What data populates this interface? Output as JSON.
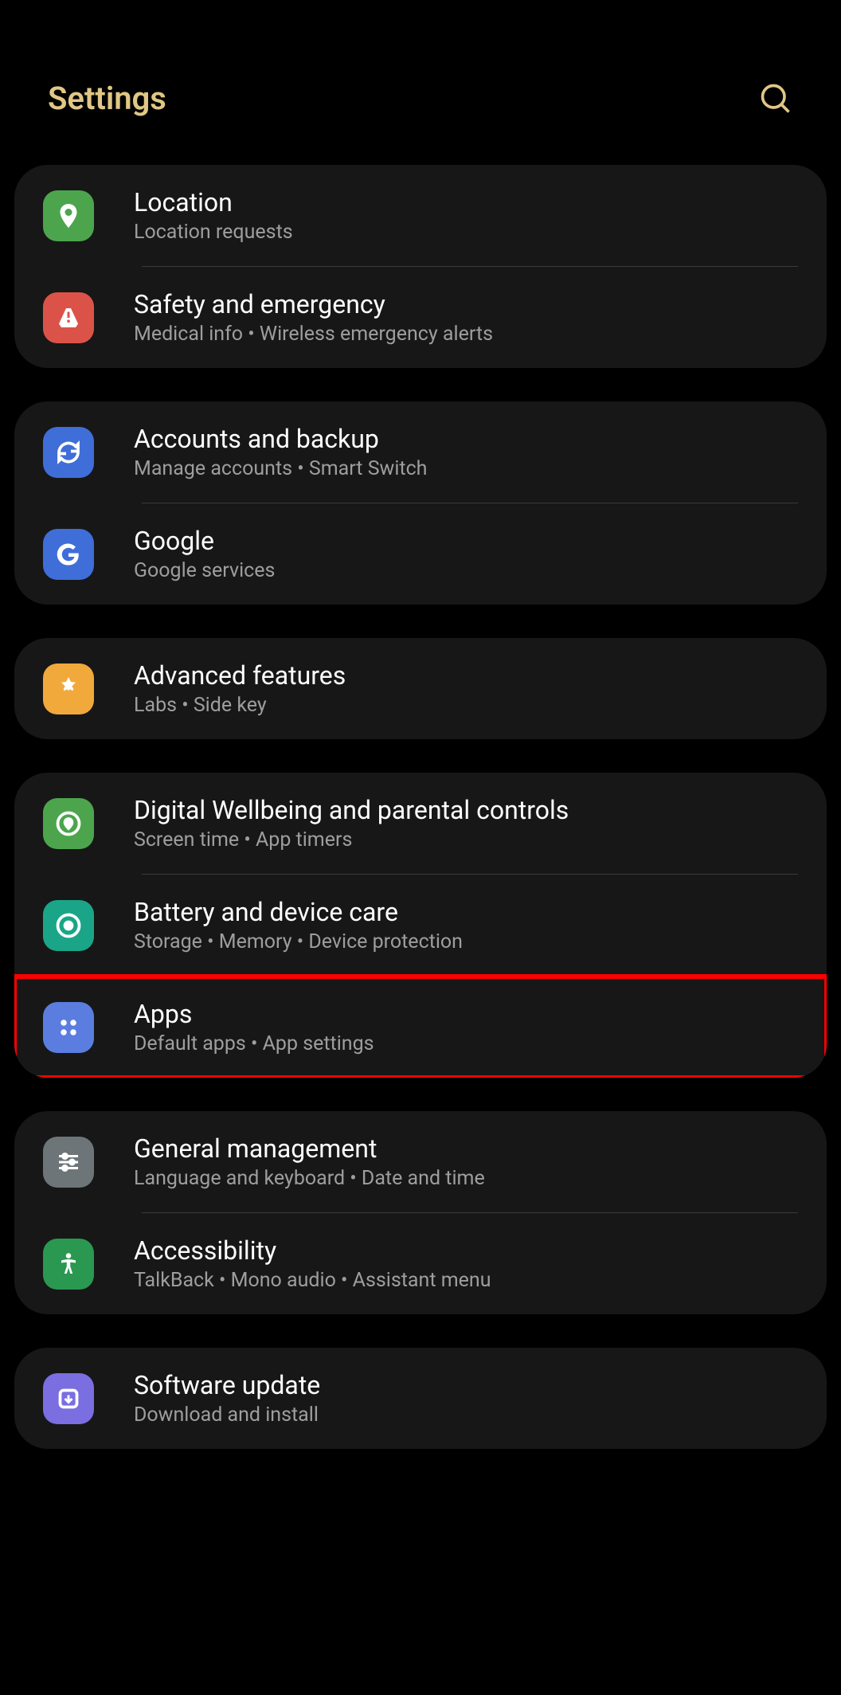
{
  "header": {
    "title": "Settings"
  },
  "groups": [
    {
      "items": [
        {
          "title": "Location",
          "subtitle": "Location requests",
          "icon": "location",
          "icon_color": "green"
        },
        {
          "title": "Safety and emergency",
          "subtitle": "Medical info  •  Wireless emergency alerts",
          "icon": "emergency",
          "icon_color": "red"
        }
      ]
    },
    {
      "items": [
        {
          "title": "Accounts and backup",
          "subtitle": "Manage accounts  •  Smart Switch",
          "icon": "sync",
          "icon_color": "blue"
        },
        {
          "title": "Google",
          "subtitle": "Google services",
          "icon": "google",
          "icon_color": "blue"
        }
      ]
    },
    {
      "items": [
        {
          "title": "Advanced features",
          "subtitle": "Labs  •  Side key",
          "icon": "advanced",
          "icon_color": "yellow"
        }
      ]
    },
    {
      "items": [
        {
          "title": "Digital Wellbeing and parental controls",
          "subtitle": "Screen time  •  App timers",
          "icon": "wellbeing",
          "icon_color": "green2"
        },
        {
          "title": "Battery and device care",
          "subtitle": "Storage  •  Memory  •  Device protection",
          "icon": "battery",
          "icon_color": "teal"
        },
        {
          "title": "Apps",
          "subtitle": "Default apps  •  App settings",
          "icon": "apps",
          "icon_color": "blue2",
          "highlighted": true
        }
      ]
    },
    {
      "items": [
        {
          "title": "General management",
          "subtitle": "Language and keyboard  •  Date and time",
          "icon": "general",
          "icon_color": "grey"
        },
        {
          "title": "Accessibility",
          "subtitle": "TalkBack  •  Mono audio  •  Assistant menu",
          "icon": "accessibility",
          "icon_color": "green3"
        }
      ]
    },
    {
      "items": [
        {
          "title": "Software update",
          "subtitle": "Download and install",
          "icon": "update",
          "icon_color": "purple"
        }
      ]
    }
  ]
}
